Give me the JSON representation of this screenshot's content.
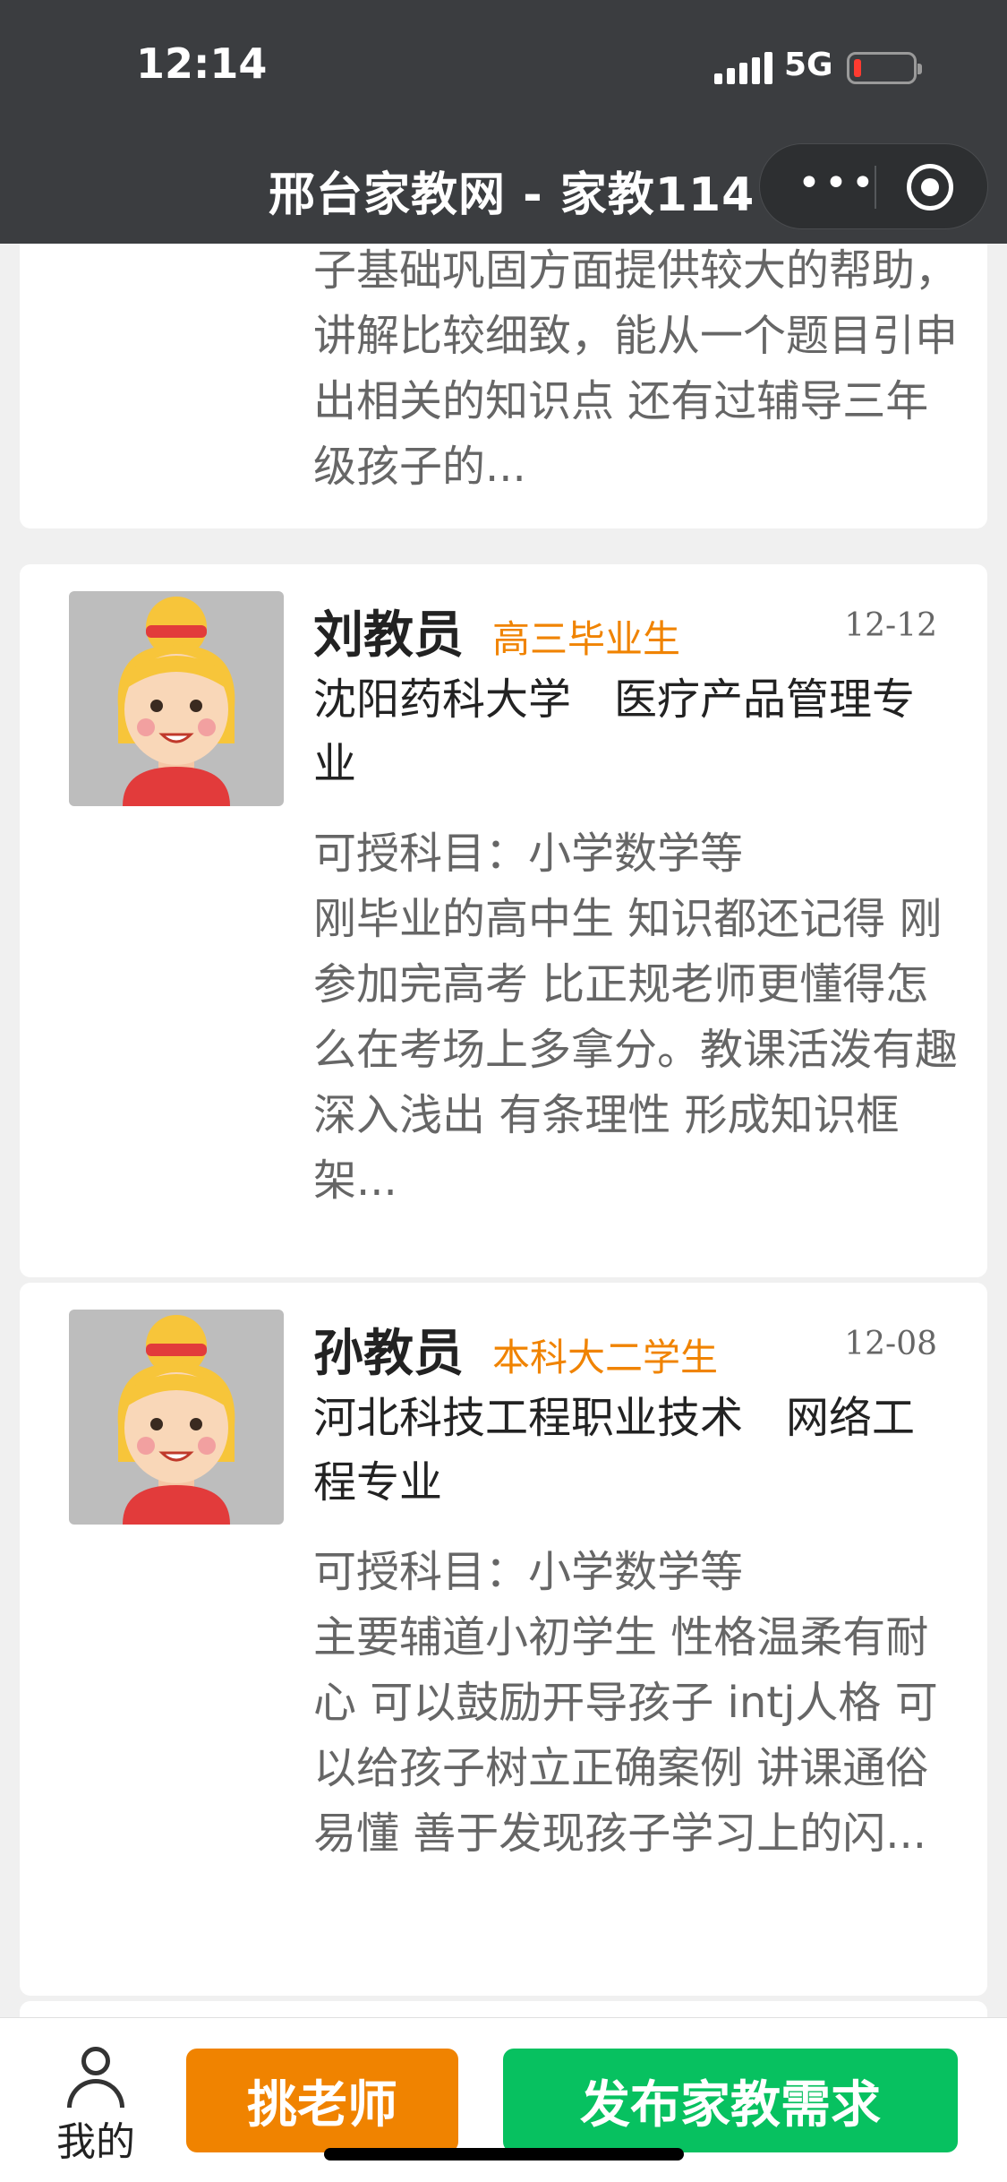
{
  "status": {
    "time": "12:14",
    "network": "5G"
  },
  "nav": {
    "title": "邢台家教网 - 家教114",
    "more_icon": "more-dots-icon",
    "target_icon": "target-icon"
  },
  "cards": [
    {
      "desc": "子基础巩固方面提供较大的帮助，讲解比较细致，能从一个题目引申出相关的知识点 还有过辅导三年级孩子的..."
    },
    {
      "name": "刘教员",
      "tag": "高三毕业生",
      "date": "12-12",
      "school": "沈阳药科大学　医疗产品管理专业",
      "subjects": "可授科目：小学数学等",
      "desc": "刚毕业的高中生 知识都还记得 刚参加完高考 比正规老师更懂得怎么在考场上多拿分。教课活泼有趣 深入浅出 有条理性 形成知识框架..."
    },
    {
      "name": "孙教员",
      "tag": "本科大二学生",
      "date": "12-08",
      "school": "河北科技工程职业技术　网络工程专业",
      "subjects": "可授科目：小学数学等",
      "desc": "主要辅道小初学生 性格温柔有耐心 可以鼓励开导孩子 intj人格 可以给孩子树立正确案例 讲课通俗易懂 善于发现孩子学习上的闪..."
    }
  ],
  "bottom": {
    "mine_label": "我的",
    "pick_label": "挑老师",
    "post_label": "发布家教需求"
  },
  "colors": {
    "accent_orange": "#f08300",
    "accent_green": "#07c160",
    "topbar": "#3b3d40"
  }
}
